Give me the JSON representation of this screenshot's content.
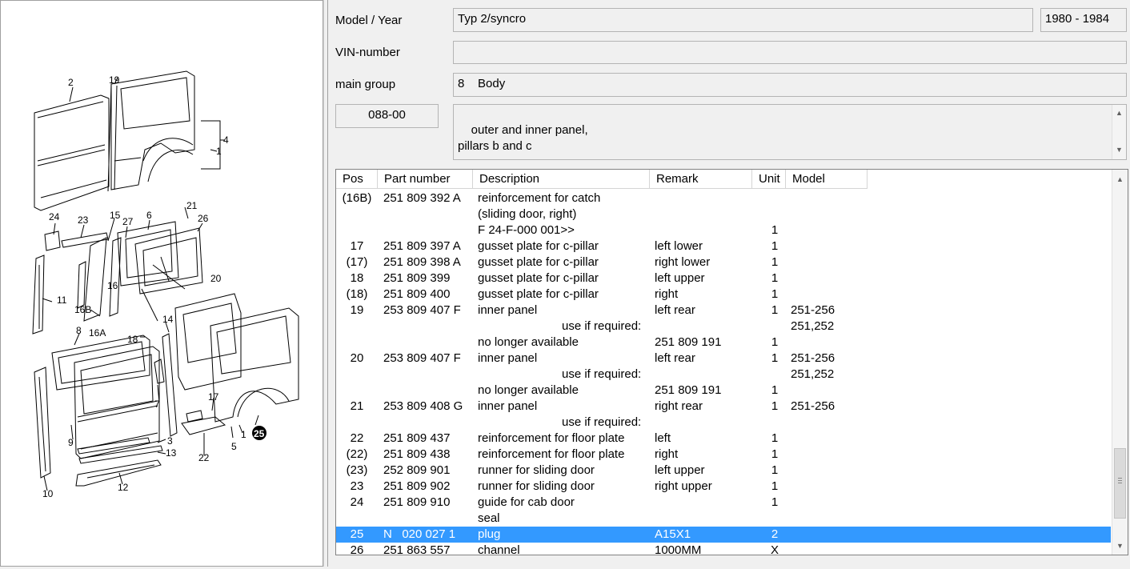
{
  "header": {
    "model_year_label": "Model / Year",
    "model_value": "Typ 2/syncro",
    "year_value": "1980 - 1984",
    "vin_label": "VIN-number",
    "vin_value": "",
    "main_group_label": "main group",
    "main_group_value": "8    Body",
    "illustration_no": "088-00",
    "description_value": "outer and inner panel,\npillars b and c"
  },
  "table": {
    "columns": [
      "Pos",
      "Part number",
      "Description",
      "Remark",
      "Unit",
      "Model"
    ],
    "rows": [
      {
        "pos": "(16B)",
        "pn": "251 809 392 A",
        "desc": "reinforcement for catch",
        "remark": "",
        "unit": "",
        "model": ""
      },
      {
        "pos": "",
        "pn": "",
        "desc": "(sliding door, right)",
        "remark": "",
        "unit": "",
        "model": ""
      },
      {
        "pos": "",
        "pn": "",
        "desc": "F 24-F-000 001>>",
        "remark": "",
        "unit": "1",
        "model": ""
      },
      {
        "pos": "17",
        "pn": "251 809 397 A",
        "desc": "gusset plate for c-pillar",
        "remark": "left lower",
        "unit": "1",
        "model": ""
      },
      {
        "pos": "(17)",
        "pn": "251 809 398 A",
        "desc": "gusset plate for c-pillar",
        "remark": "right lower",
        "unit": "1",
        "model": ""
      },
      {
        "pos": "18",
        "pn": "251 809 399",
        "desc": "gusset plate for c-pillar",
        "remark": "left upper",
        "unit": "1",
        "model": ""
      },
      {
        "pos": "(18)",
        "pn": "251 809 400",
        "desc": "gusset plate for c-pillar",
        "remark": "right",
        "unit": "1",
        "model": ""
      },
      {
        "pos": "19",
        "pn": "253 809 407 F",
        "desc": "inner panel",
        "remark": "left rear",
        "unit": "1",
        "model": "251-256"
      },
      {
        "pos": "",
        "pn": "",
        "desc": "use if required:",
        "remark": "",
        "unit": "",
        "model": "251,252",
        "indent": true
      },
      {
        "pos": "",
        "pn": "",
        "desc": "no longer available",
        "remark": "251 809 191",
        "unit": "1",
        "model": ""
      },
      {
        "pos": "20",
        "pn": "253 809 407 F",
        "desc": "inner panel",
        "remark": "left rear",
        "unit": "1",
        "model": "251-256"
      },
      {
        "pos": "",
        "pn": "",
        "desc": "use if required:",
        "remark": "",
        "unit": "",
        "model": "251,252",
        "indent": true
      },
      {
        "pos": "",
        "pn": "",
        "desc": "no longer available",
        "remark": "251 809 191",
        "unit": "1",
        "model": ""
      },
      {
        "pos": "21",
        "pn": "253 809 408 G",
        "desc": "inner panel",
        "remark": "right rear",
        "unit": "1",
        "model": "251-256"
      },
      {
        "pos": "",
        "pn": "",
        "desc": "use if required:",
        "remark": "",
        "unit": "",
        "model": "",
        "indent": true
      },
      {
        "pos": "22",
        "pn": "251 809 437",
        "desc": "reinforcement for floor plate",
        "remark": "left",
        "unit": "1",
        "model": ""
      },
      {
        "pos": "(22)",
        "pn": "251 809 438",
        "desc": "reinforcement for floor plate",
        "remark": "right",
        "unit": "1",
        "model": ""
      },
      {
        "pos": "(23)",
        "pn": "252 809 901",
        "desc": "runner for sliding door",
        "remark": "left upper",
        "unit": "1",
        "model": ""
      },
      {
        "pos": "23",
        "pn": "251 809 902",
        "desc": "runner for sliding door",
        "remark": "right upper",
        "unit": "1",
        "model": ""
      },
      {
        "pos": "24",
        "pn": "251 809 910",
        "desc": "guide for cab door",
        "remark": "",
        "unit": "1",
        "model": ""
      },
      {
        "pos": "",
        "pn": "",
        "desc": "seal",
        "remark": "",
        "unit": "",
        "model": ""
      },
      {
        "pos": "25",
        "pn": "N   020 027 1",
        "desc": "plug",
        "remark": "A15X1",
        "unit": "2",
        "model": "",
        "selected": true
      },
      {
        "pos": "26",
        "pn": "251 863 557",
        "desc": "channel",
        "remark": "1000MM",
        "unit": "X",
        "model": ""
      }
    ]
  },
  "diagram": {
    "callouts": [
      "2",
      "19",
      "4",
      "1",
      "24",
      "23",
      "15",
      "27",
      "6",
      "21",
      "26",
      "11",
      "16",
      "16B",
      "16A",
      "20",
      "8",
      "18",
      "14",
      "7",
      "9",
      "3",
      "13",
      "12",
      "10",
      "22",
      "17",
      "5",
      "1",
      "25"
    ],
    "highlighted_callout": "25"
  },
  "colors": {
    "selection": "#3399ff",
    "panel_bg": "#f0f0f0",
    "grid_bg": "#ffffff"
  }
}
